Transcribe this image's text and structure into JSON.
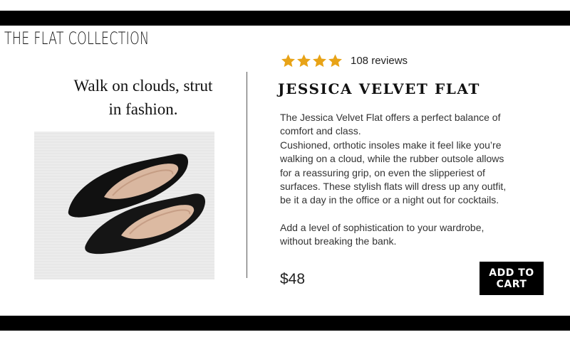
{
  "brand": {
    "name": "THE FLAT COLLECTION"
  },
  "hero": {
    "tagline_line1": "Walk on clouds, strut",
    "tagline_line2": "in fashion.",
    "image_description": "black-suede-pointed-flats"
  },
  "product": {
    "rating_stars": 4,
    "rating_max": 4,
    "reviews_label": "108 reviews",
    "name": "JESSICA VELVET FLAT",
    "description": [
      "The Jessica Velvet Flat offers a perfect balance of comfort and class.",
      "Cushioned, orthotic insoles make it feel like you’re walking on a cloud, while the rubber outsole allows for a reassuring grip, on even the slipperiest of surfaces. These stylish flats will dress up any outfit, be it a day in the office or a night out for cocktails.",
      "Add a level of sophistication to your wardrobe, without breaking the bank."
    ],
    "price": "$48",
    "cart_line1": "ADD TO",
    "cart_line2": "CART"
  },
  "colors": {
    "star": "#e8a317",
    "bars": "#000000",
    "button_bg": "#000000",
    "button_text": "#ffffff"
  },
  "icons": {
    "rating": "star-icon"
  }
}
